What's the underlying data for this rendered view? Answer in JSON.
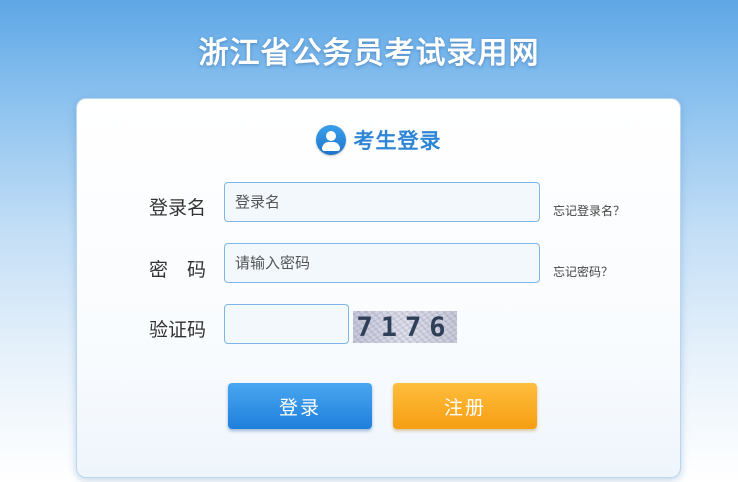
{
  "header": {
    "title": "浙江省公务员考试录用网"
  },
  "login_card": {
    "title": "考生登录",
    "icon": "user-avatar-icon",
    "username": {
      "label": "登录名",
      "placeholder": "登录名",
      "forgot": "忘记登录名？"
    },
    "password": {
      "label": "密　码",
      "placeholder": "请输入密码",
      "forgot": "忘记密码？"
    },
    "captcha": {
      "label": "验证码",
      "value": "",
      "image_text": "7176"
    },
    "buttons": {
      "login": "登录",
      "register": "注册"
    }
  },
  "colors": {
    "primary_blue": "#2f86d6",
    "login_button": "#1f80dc",
    "register_button": "#f59e12"
  }
}
